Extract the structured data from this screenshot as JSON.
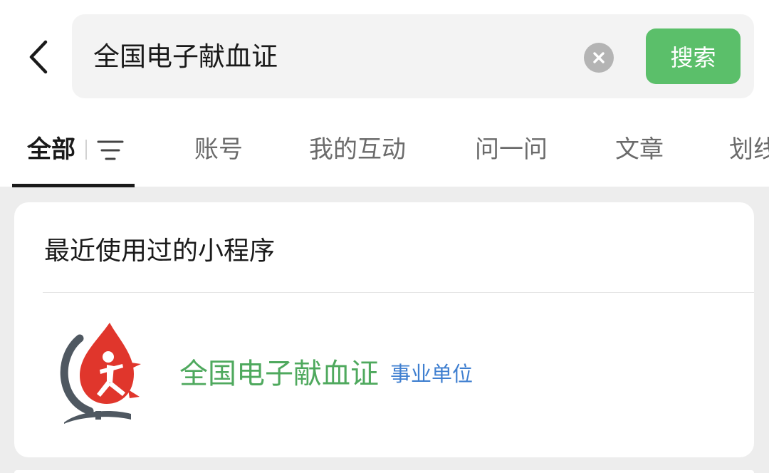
{
  "search": {
    "query": "全国电子献血证",
    "button_label": "搜索"
  },
  "tabs": [
    {
      "label": "全部",
      "active": true
    },
    {
      "label": "账号",
      "active": false
    },
    {
      "label": "我的互动",
      "active": false
    },
    {
      "label": "问一问",
      "active": false
    },
    {
      "label": "文章",
      "active": false
    },
    {
      "label": "划线",
      "active": false
    }
  ],
  "recent_section": {
    "title": "最近使用过的小程序",
    "items": [
      {
        "name": "全国电子献血证",
        "badge": "事业单位",
        "icon": "blood-drop-globe-logo"
      }
    ]
  },
  "colors": {
    "accent_green": "#5bbf6a",
    "name_green": "#4fa95e",
    "badge_blue": "#3f7fd0",
    "logo_red": "#e0362c"
  },
  "icons": [
    "back-arrow-icon",
    "clear-icon",
    "filter-icon"
  ]
}
